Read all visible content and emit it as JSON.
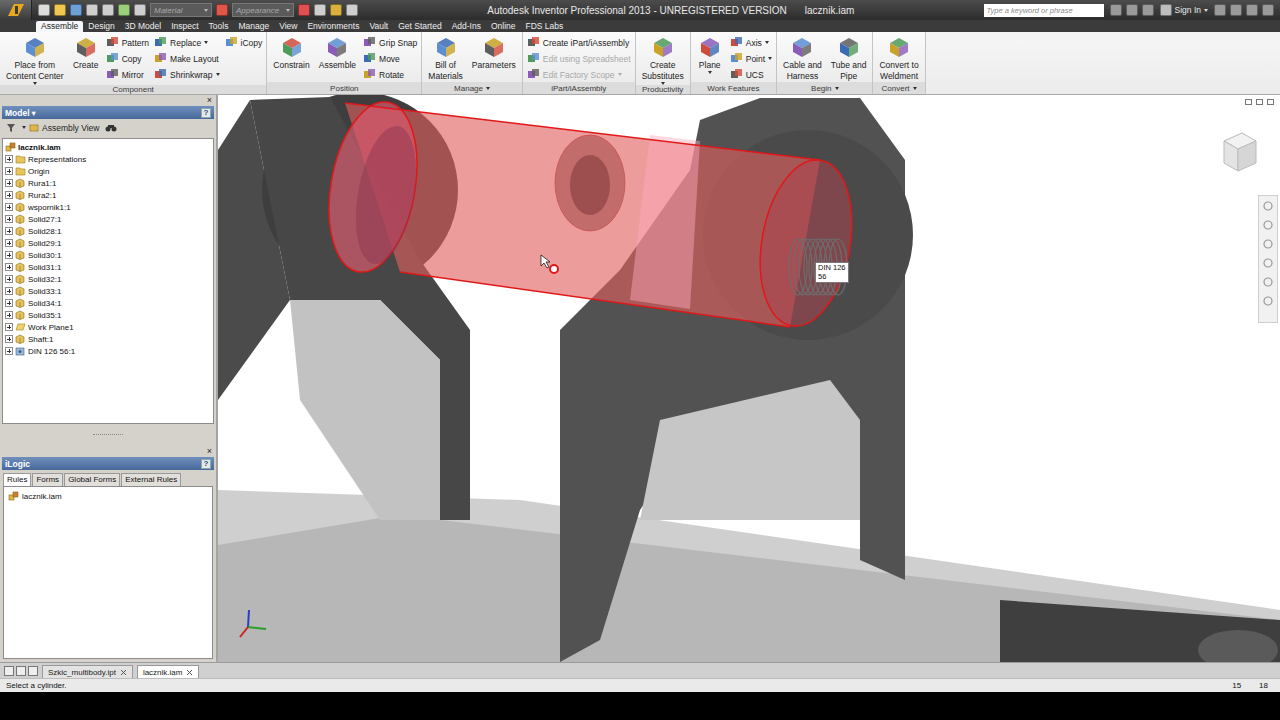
{
  "window": {
    "title": "Autodesk Inventor Professional 2013 - UNREGISTERED VERSION",
    "document": "lacznik.iam"
  },
  "quick_access": {
    "material": "Material",
    "appearance": "Appearance"
  },
  "search": {
    "placeholder": "Type a keyword or phrase"
  },
  "account": {
    "label": "Sign In"
  },
  "ribbon_tabs": [
    {
      "label": "Assemble",
      "selected": true
    },
    {
      "label": "Design",
      "selected": false
    },
    {
      "label": "3D Model",
      "selected": false
    },
    {
      "label": "Inspect",
      "selected": false
    },
    {
      "label": "Tools",
      "selected": false
    },
    {
      "label": "Manage",
      "selected": false
    },
    {
      "label": "View",
      "selected": false
    },
    {
      "label": "Environments",
      "selected": false
    },
    {
      "label": "Vault",
      "selected": false
    },
    {
      "label": "Get Started",
      "selected": false
    },
    {
      "label": "Add-Ins",
      "selected": false
    },
    {
      "label": "Online",
      "selected": false
    },
    {
      "label": "FDS Labs",
      "selected": false
    }
  ],
  "ribbon_groups": [
    {
      "label": "Component",
      "dropdown": false,
      "columns": [
        {
          "kind": "large",
          "items": [
            {
              "lines": [
                "Place from",
                "Content Center"
              ],
              "dropdown": true,
              "disabled": false
            },
            {
              "lines": [
                "Create"
              ],
              "dropdown": false,
              "disabled": false
            }
          ]
        },
        {
          "kind": "small",
          "items": [
            {
              "lines": [
                "Pattern"
              ],
              "dropdown": false,
              "disabled": false
            },
            {
              "lines": [
                "Copy"
              ],
              "dropdown": false,
              "disabled": false
            },
            {
              "lines": [
                "Mirror"
              ],
              "dropdown": false,
              "disabled": false
            }
          ]
        },
        {
          "kind": "small",
          "items": [
            {
              "lines": [
                "Replace"
              ],
              "dropdown": true,
              "disabled": false
            },
            {
              "lines": [
                "Make Layout"
              ],
              "dropdown": false,
              "disabled": false
            },
            {
              "lines": [
                "Shrinkwrap"
              ],
              "dropdown": true,
              "disabled": false
            }
          ]
        },
        {
          "kind": "small",
          "items": [
            {
              "lines": [
                "iCopy"
              ],
              "dropdown": false,
              "disabled": false
            }
          ]
        }
      ]
    },
    {
      "label": "Position",
      "dropdown": false,
      "columns": [
        {
          "kind": "large",
          "items": [
            {
              "lines": [
                "Constrain"
              ],
              "dropdown": false,
              "disabled": false
            },
            {
              "lines": [
                "Assemble"
              ],
              "dropdown": false,
              "disabled": false
            }
          ]
        },
        {
          "kind": "small",
          "items": [
            {
              "lines": [
                "Grip Snap"
              ],
              "dropdown": false,
              "disabled": false
            },
            {
              "lines": [
                "Move"
              ],
              "dropdown": false,
              "disabled": false
            },
            {
              "lines": [
                "Rotate"
              ],
              "dropdown": false,
              "disabled": false
            }
          ]
        }
      ]
    },
    {
      "label": "Manage",
      "dropdown": true,
      "columns": [
        {
          "kind": "large",
          "items": [
            {
              "lines": [
                "Bill of",
                "Materials"
              ],
              "dropdown": false,
              "disabled": false
            },
            {
              "lines": [
                "Parameters"
              ],
              "dropdown": false,
              "disabled": false
            }
          ]
        }
      ]
    },
    {
      "label": "iPart/iAssembly",
      "dropdown": false,
      "columns": [
        {
          "kind": "small",
          "items": [
            {
              "lines": [
                "Create iPart/iAssembly"
              ],
              "dropdown": false,
              "disabled": false
            },
            {
              "lines": [
                "Edit using Spreadsheet"
              ],
              "dropdown": false,
              "disabled": true
            },
            {
              "lines": [
                "Edit Factory Scope"
              ],
              "dropdown": true,
              "disabled": true
            }
          ]
        }
      ]
    },
    {
      "label": "Productivity",
      "dropdown": false,
      "columns": [
        {
          "kind": "large",
          "items": [
            {
              "lines": [
                "Create",
                "Substitutes"
              ],
              "dropdown": true,
              "disabled": false
            }
          ]
        }
      ]
    },
    {
      "label": "Work Features",
      "dropdown": false,
      "columns": [
        {
          "kind": "large",
          "items": [
            {
              "lines": [
                "Plane"
              ],
              "dropdown": true,
              "disabled": false
            }
          ]
        },
        {
          "kind": "small",
          "items": [
            {
              "lines": [
                "Axis"
              ],
              "dropdown": true,
              "disabled": false
            },
            {
              "lines": [
                "Point"
              ],
              "dropdown": true,
              "disabled": false
            },
            {
              "lines": [
                "UCS"
              ],
              "dropdown": false,
              "disabled": false
            }
          ]
        }
      ]
    },
    {
      "label": "Begin",
      "dropdown": true,
      "columns": [
        {
          "kind": "large",
          "items": [
            {
              "lines": [
                "Cable and",
                "Harness"
              ],
              "dropdown": false,
              "disabled": false
            },
            {
              "lines": [
                "Tube and",
                "Pipe"
              ],
              "dropdown": false,
              "disabled": false
            }
          ]
        }
      ]
    },
    {
      "label": "Convert",
      "dropdown": true,
      "columns": [
        {
          "kind": "large",
          "items": [
            {
              "lines": [
                "Convert to",
                "Weldment"
              ],
              "dropdown": false,
              "disabled": false
            }
          ]
        }
      ]
    }
  ],
  "model_browser": {
    "title": "Model",
    "menu_arrow": "▾",
    "help": "?",
    "close": "×",
    "view": "Assembly View",
    "items": [
      {
        "label": "lacznik.iam",
        "kind": "assembly",
        "depth": 0,
        "expandable": false,
        "expanded": true
      },
      {
        "label": "Representations",
        "kind": "folder",
        "depth": 1,
        "expandable": true,
        "expanded": false
      },
      {
        "label": "Origin",
        "kind": "folder",
        "depth": 1,
        "expandable": true,
        "expanded": false
      },
      {
        "label": "Rura1:1",
        "kind": "part",
        "depth": 1,
        "expandable": true,
        "expanded": false
      },
      {
        "label": "Rura2:1",
        "kind": "part",
        "depth": 1,
        "expandable": true,
        "expanded": false
      },
      {
        "label": "wspornik1:1",
        "kind": "part",
        "depth": 1,
        "expandable": true,
        "expanded": false
      },
      {
        "label": "Solid27:1",
        "kind": "part",
        "depth": 1,
        "expandable": true,
        "expanded": false
      },
      {
        "label": "Solid28:1",
        "kind": "part",
        "depth": 1,
        "expandable": true,
        "expanded": false
      },
      {
        "label": "Solid29:1",
        "kind": "part",
        "depth": 1,
        "expandable": true,
        "expanded": false
      },
      {
        "label": "Solid30:1",
        "kind": "part",
        "depth": 1,
        "expandable": true,
        "expanded": false
      },
      {
        "label": "Solid31:1",
        "kind": "part",
        "depth": 1,
        "expandable": true,
        "expanded": false
      },
      {
        "label": "Solid32:1",
        "kind": "part",
        "depth": 1,
        "expandable": true,
        "expanded": false
      },
      {
        "label": "Solid33:1",
        "kind": "part",
        "depth": 1,
        "expandable": true,
        "expanded": false
      },
      {
        "label": "Solid34:1",
        "kind": "part",
        "depth": 1,
        "expandable": true,
        "expanded": false
      },
      {
        "label": "Solid35:1",
        "kind": "part",
        "depth": 1,
        "expandable": true,
        "expanded": false
      },
      {
        "label": "Work Plane1",
        "kind": "workplane",
        "depth": 1,
        "expandable": true,
        "expanded": false
      },
      {
        "label": "Shaft:1",
        "kind": "part",
        "depth": 1,
        "expandable": true,
        "expanded": false
      },
      {
        "label": "DIN 126 56:1",
        "kind": "content",
        "depth": 1,
        "expandable": true,
        "expanded": false
      }
    ]
  },
  "ilogic": {
    "title": "iLogic",
    "help": "?",
    "close": "×",
    "tabs": [
      {
        "label": "Rules",
        "selected": true
      },
      {
        "label": "Forms",
        "selected": false
      },
      {
        "label": "Global Forms",
        "selected": false
      },
      {
        "label": "External Rules",
        "selected": false
      }
    ],
    "rules": [
      {
        "label": "lacznik.iam"
      }
    ]
  },
  "viewport": {
    "tooltip": [
      "DIN 126",
      "56"
    ]
  },
  "document_tabs": [
    {
      "label": "Szkic_multibody.ipt",
      "selected": false
    },
    {
      "label": "lacznik.iam",
      "selected": true
    }
  ],
  "status_bar": {
    "message": "Select a cylinder.",
    "readings": [
      "15",
      "18"
    ]
  }
}
